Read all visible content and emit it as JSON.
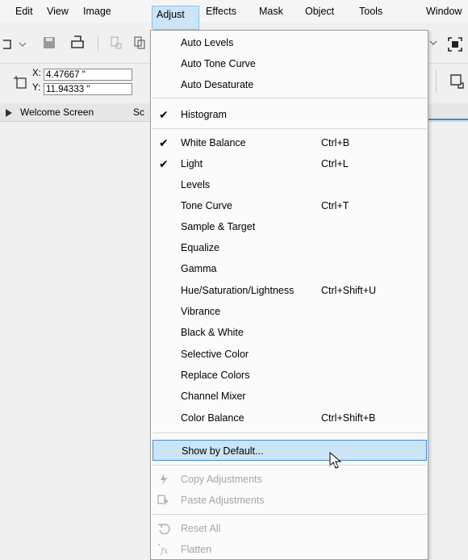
{
  "menubar": {
    "items": [
      "Edit",
      "View",
      "Image",
      "Adjust",
      "Effects",
      "Mask",
      "Object",
      "Tools",
      "Window"
    ],
    "active": "Adjust"
  },
  "propbar": {
    "x_label": "X:",
    "x_value": "4.47667 \"",
    "y_label": "Y:",
    "y_value": "11.94333 \""
  },
  "tabs": {
    "welcome": "Welcome Screen",
    "second": "Sc"
  },
  "menu": {
    "items": [
      {
        "label": "Auto Levels",
        "shortcut": "",
        "checked": false,
        "disabled": false
      },
      {
        "label": "Auto Tone Curve",
        "shortcut": "",
        "checked": false,
        "disabled": false
      },
      {
        "label": "Auto Desaturate",
        "shortcut": "",
        "checked": false,
        "disabled": false
      },
      {
        "label": "Histogram",
        "shortcut": "",
        "checked": true,
        "disabled": false
      },
      {
        "label": "White Balance",
        "shortcut": "Ctrl+B",
        "checked": true,
        "disabled": false
      },
      {
        "label": "Light",
        "shortcut": "Ctrl+L",
        "checked": true,
        "disabled": false
      },
      {
        "label": "Levels",
        "shortcut": "",
        "checked": false,
        "disabled": false
      },
      {
        "label": "Tone Curve",
        "shortcut": "Ctrl+T",
        "checked": false,
        "disabled": false
      },
      {
        "label": "Sample & Target",
        "shortcut": "",
        "checked": false,
        "disabled": false
      },
      {
        "label": "Equalize",
        "shortcut": "",
        "checked": false,
        "disabled": false
      },
      {
        "label": "Gamma",
        "shortcut": "",
        "checked": false,
        "disabled": false
      },
      {
        "label": "Hue/Saturation/Lightness",
        "shortcut": "Ctrl+Shift+U",
        "checked": false,
        "disabled": false
      },
      {
        "label": "Vibrance",
        "shortcut": "",
        "checked": false,
        "disabled": false
      },
      {
        "label": "Black & White",
        "shortcut": "",
        "checked": false,
        "disabled": false
      },
      {
        "label": "Selective Color",
        "shortcut": "",
        "checked": false,
        "disabled": false
      },
      {
        "label": "Replace Colors",
        "shortcut": "",
        "checked": false,
        "disabled": false
      },
      {
        "label": "Channel Mixer",
        "shortcut": "",
        "checked": false,
        "disabled": false
      },
      {
        "label": "Color Balance",
        "shortcut": "Ctrl+Shift+B",
        "checked": false,
        "disabled": false
      },
      {
        "label": "Show by Default...",
        "shortcut": "",
        "checked": false,
        "disabled": false,
        "highlighted": true
      },
      {
        "label": "Copy Adjustments",
        "shortcut": "",
        "checked": false,
        "disabled": true,
        "icon": "copy-adjustments-icon"
      },
      {
        "label": "Paste Adjustments",
        "shortcut": "",
        "checked": false,
        "disabled": true,
        "icon": "paste-adjustments-icon"
      },
      {
        "label": "Reset All",
        "shortcut": "",
        "checked": false,
        "disabled": true,
        "icon": "reset-icon"
      },
      {
        "label": "Flatten",
        "shortcut": "",
        "checked": false,
        "disabled": true,
        "icon": "flatten-icon"
      }
    ]
  },
  "colors": {
    "highlight_bg": "#cce4f7",
    "highlight_border": "#3b8cd6",
    "disabled_text": "#a4a4a4"
  }
}
